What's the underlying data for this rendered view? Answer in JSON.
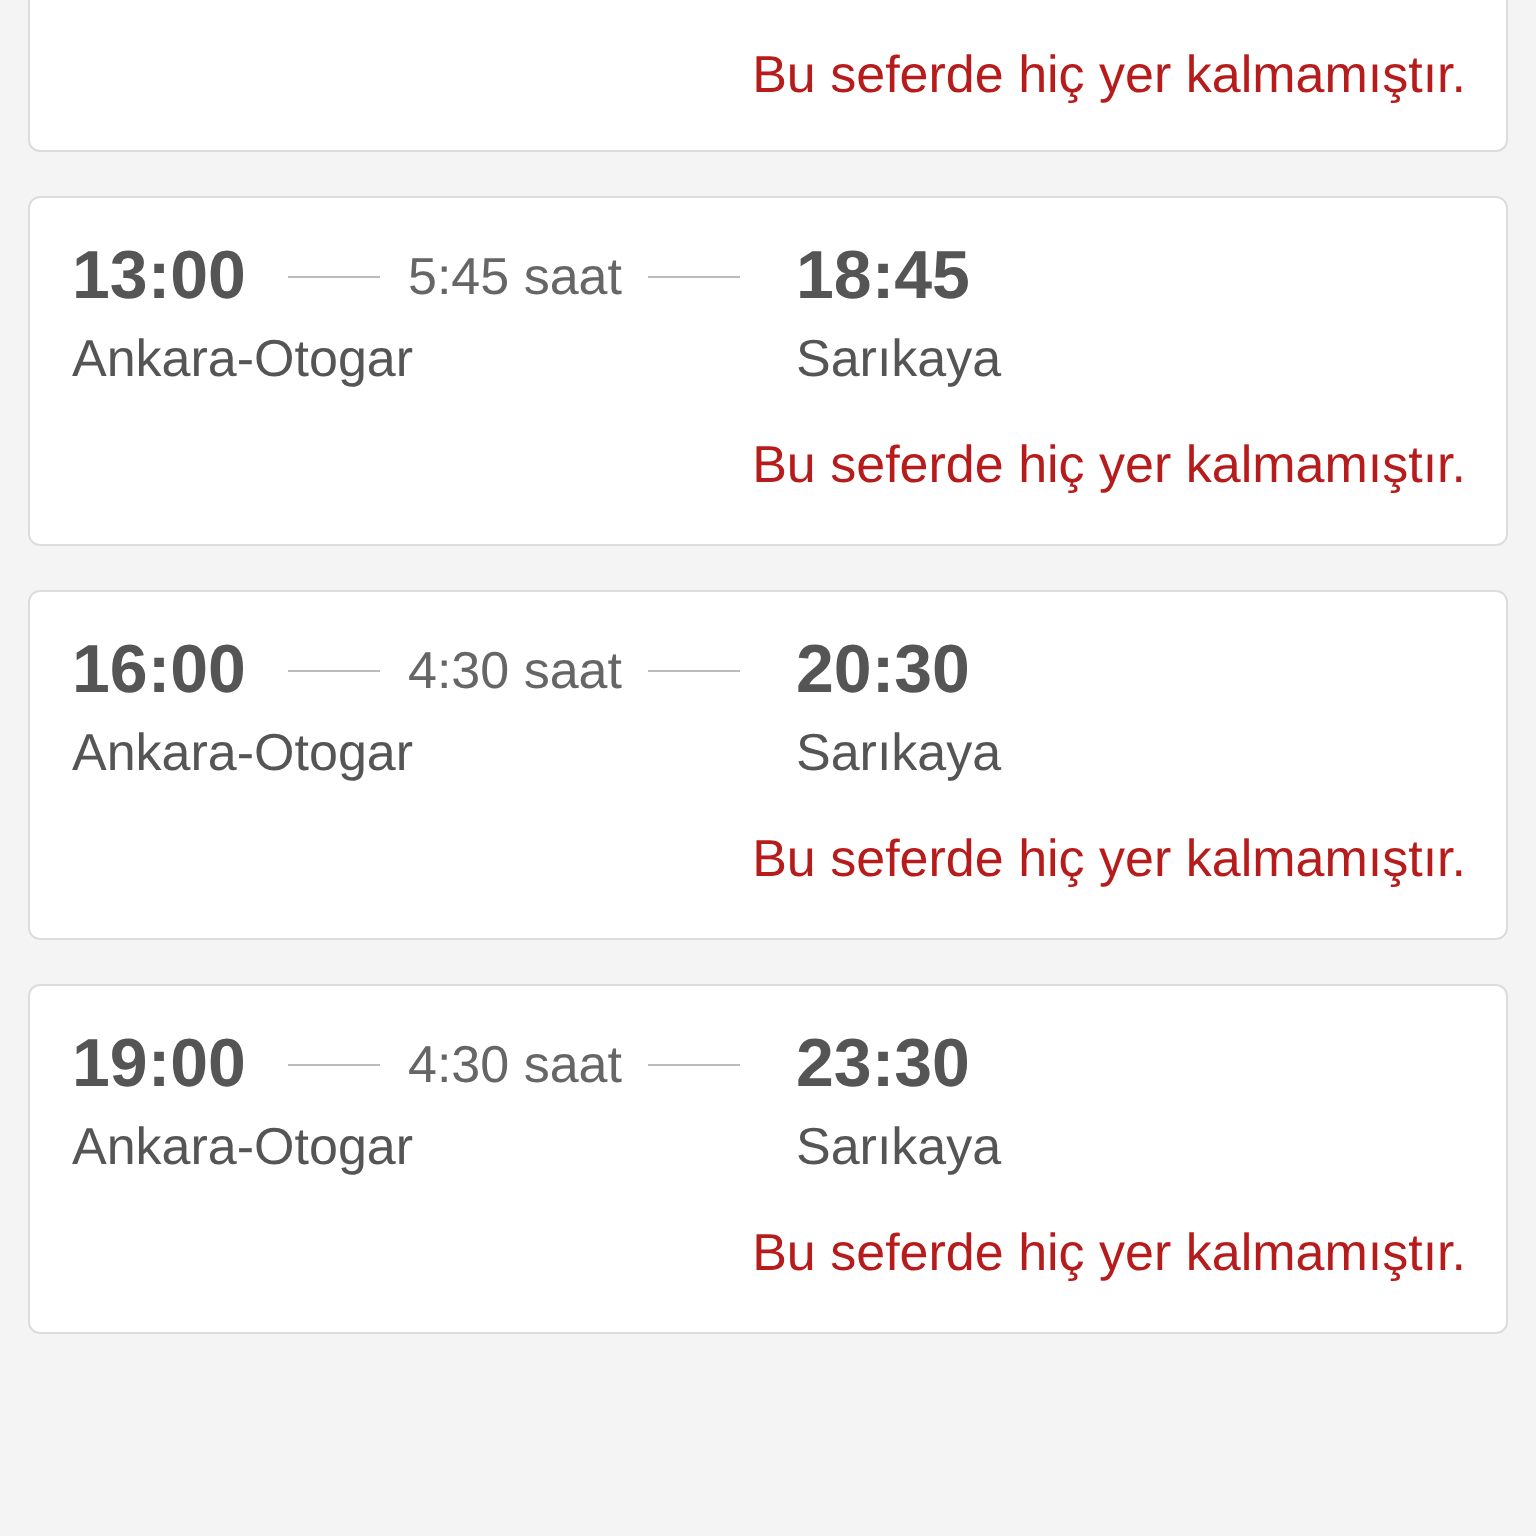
{
  "trips": [
    {
      "notice": "Bu seferde hiç yer kalmamıştır."
    },
    {
      "departure_time": "13:00",
      "duration": "5:45 saat",
      "arrival_time": "18:45",
      "departure_station": "Ankara-Otogar",
      "arrival_station": "Sarıkaya",
      "notice": "Bu seferde hiç yer kalmamıştır."
    },
    {
      "departure_time": "16:00",
      "duration": "4:30 saat",
      "arrival_time": "20:30",
      "departure_station": "Ankara-Otogar",
      "arrival_station": "Sarıkaya",
      "notice": "Bu seferde hiç yer kalmamıştır."
    },
    {
      "departure_time": "19:00",
      "duration": "4:30 saat",
      "arrival_time": "23:30",
      "departure_station": "Ankara-Otogar",
      "arrival_station": "Sarıkaya",
      "notice": "Bu seferde hiç yer kalmamıştır."
    }
  ]
}
